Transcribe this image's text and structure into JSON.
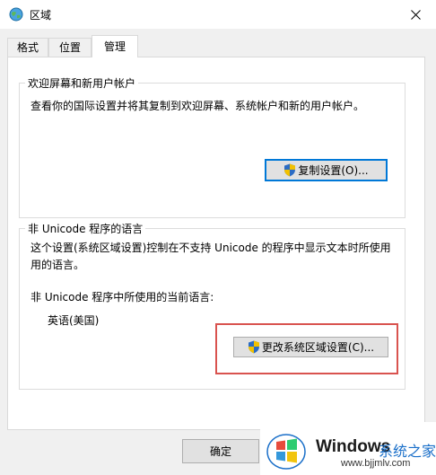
{
  "window": {
    "title": "区域",
    "close_icon": "close-icon",
    "globe_icon": "globe-icon"
  },
  "tabs": [
    {
      "label": "格式",
      "active": false
    },
    {
      "label": "位置",
      "active": false
    },
    {
      "label": "管理",
      "active": true
    }
  ],
  "welcome_group": {
    "title": "欢迎屏幕和新用户帐户",
    "description": "查看你的国际设置并将其复制到欢迎屏幕、系统帐户和新的用户帐户。",
    "copy_button": "复制设置(O)..."
  },
  "unicode_group": {
    "title": "非 Unicode 程序的语言",
    "description_line1": "这个设置(系统区域设置)控制在不支持 Unicode 的程序中显示文本时所使用",
    "description_line2": "用的语言。",
    "current_label": "非 Unicode 程序中所使用的当前语言:",
    "current_value": "英语(美国)",
    "change_button": "更改系统区域设置(C)..."
  },
  "footer": {
    "ok_button": "确定"
  },
  "watermark": {
    "brand": "Windows",
    "site_name": "系统之家",
    "url": "www.bjjmlv.com"
  },
  "colors": {
    "accent": "#0078d7",
    "highlight": "#d9534f",
    "window_bg": "#f0f0f0"
  }
}
